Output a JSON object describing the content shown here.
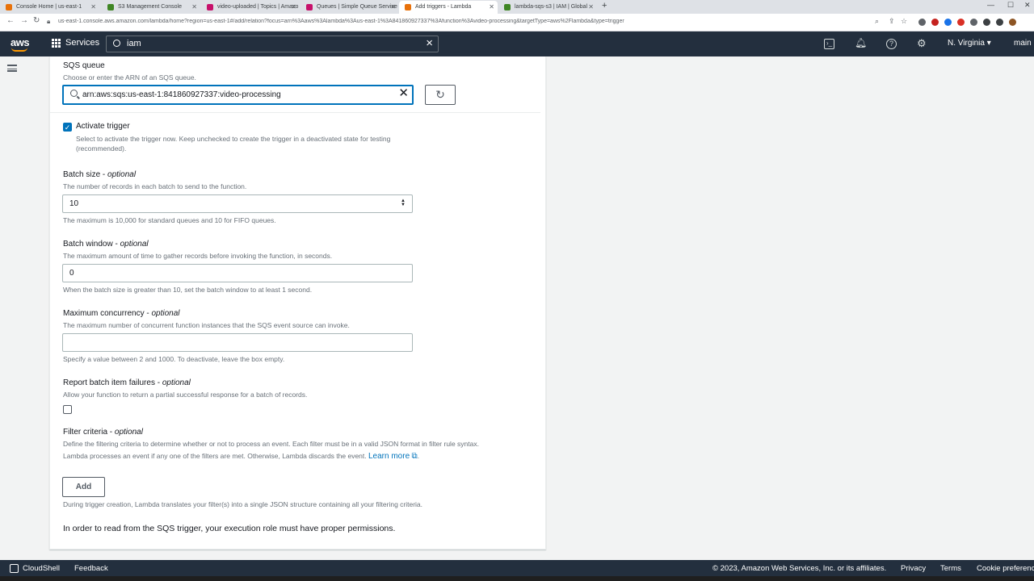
{
  "browser": {
    "tabs": [
      {
        "title": "Console Home | us-east-1",
        "color": "#e8710a"
      },
      {
        "title": "S3 Management Console",
        "color": "#3f8624"
      },
      {
        "title": "video-uploaded | Topics | Amazo",
        "color": "#c7116b"
      },
      {
        "title": "Queues | Simple Queue Service",
        "color": "#c7116b"
      },
      {
        "title": "Add triggers - Lambda",
        "color": "#e8710a"
      },
      {
        "title": "lambda-sqs-s3 | IAM | Global",
        "color": "#3f8624"
      }
    ],
    "url": "us-east-1.console.aws.amazon.com/lambda/home?region=us-east-1#/add/relation?focus=arn%3Aaws%3Alambda%3Aus-east-1%3A841860927337%3Afunction%3Avideo-processing&targetType=aws%2Flambda&type=trigger"
  },
  "nav": {
    "logo": "aws",
    "services": "Services",
    "search_value": "iam",
    "region": "N. Virginia ▾",
    "account": "main"
  },
  "form": {
    "sqs": {
      "label": "SQS queue",
      "desc": "Choose or enter the ARN of an SQS queue.",
      "value": "arn:aws:sqs:us-east-1:841860927337:video-processing"
    },
    "activate": {
      "label": "Activate trigger",
      "desc": "Select to activate the trigger now. Keep unchecked to create the trigger in a deactivated state for testing (recommended).",
      "checked": true
    },
    "batch_size": {
      "label": "Batch size - ",
      "optional": "optional",
      "desc": "The number of records in each batch to send to the function.",
      "value": "10",
      "hint": "The maximum is 10,000 for standard queues and 10 for FIFO queues."
    },
    "batch_window": {
      "label": "Batch window - ",
      "optional": "optional",
      "desc": "The maximum amount of time to gather records before invoking the function, in seconds.",
      "value": "0",
      "hint": "When the batch size is greater than 10, set the batch window to at least 1 second."
    },
    "max_concurrency": {
      "label": "Maximum concurrency - ",
      "optional": "optional",
      "desc": "The maximum number of concurrent function instances that the SQS event source can invoke.",
      "value": "",
      "hint": "Specify a value between 2 and 1000. To deactivate, leave the box empty."
    },
    "report_failures": {
      "label": "Report batch item failures - ",
      "optional": "optional",
      "desc": "Allow your function to return a partial successful response for a batch of records.",
      "checked": false
    },
    "filter": {
      "label": "Filter criteria - ",
      "optional": "optional",
      "desc1": "Define the filtering criteria to determine whether or not to process an event. Each filter must be in a valid JSON format in filter rule syntax.",
      "desc2": "Lambda processes an event if any one of the filters are met. Otherwise, Lambda discards the event.",
      "learn_more": "Learn more",
      "add": "Add",
      "hint": "During trigger creation, Lambda translates your filter(s) into a single JSON structure containing all your filtering criteria."
    },
    "permissions_note": "In order to read from the SQS trigger, your execution role must have proper permissions."
  },
  "footer": {
    "cloudshell": "CloudShell",
    "feedback": "Feedback",
    "copyright": "© 2023, Amazon Web Services, Inc. or its affiliates.",
    "privacy": "Privacy",
    "terms": "Terms",
    "cookies": "Cookie preferences"
  }
}
